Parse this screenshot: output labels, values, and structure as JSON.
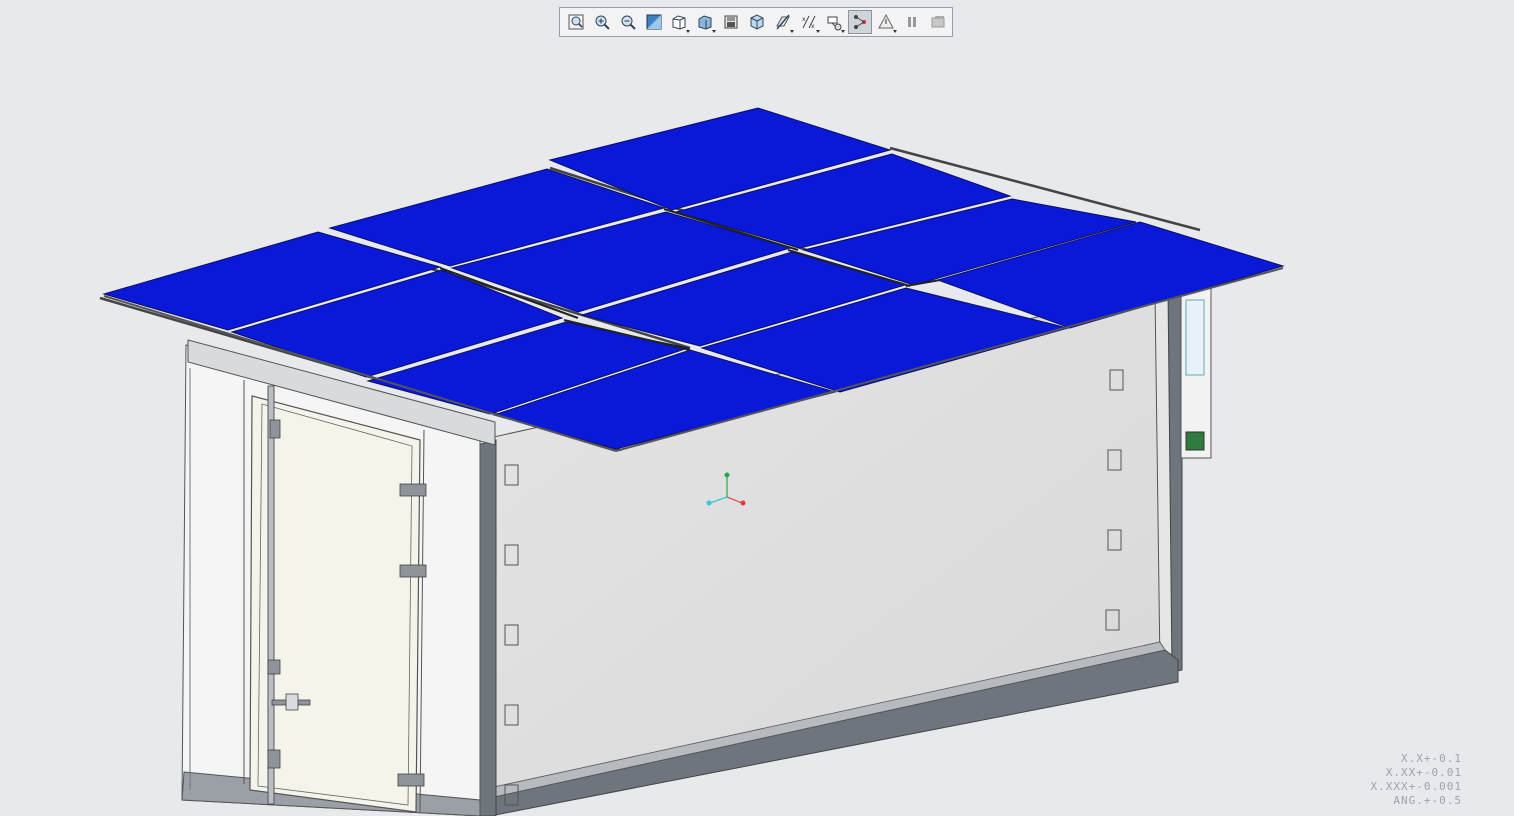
{
  "toolbar": {
    "buttons": [
      {
        "icon": "refit-icon",
        "active": false
      },
      {
        "icon": "zoom-in-icon",
        "active": false
      },
      {
        "icon": "zoom-out-icon",
        "active": false
      },
      {
        "icon": "repaint-icon",
        "active": false
      },
      {
        "icon": "saved-orientations-icon",
        "active": false
      },
      {
        "icon": "display-style-icon",
        "active": false
      },
      {
        "icon": "view-manager-icon",
        "active": false
      },
      {
        "icon": "perspective-view-icon",
        "active": false
      },
      {
        "icon": "section-icon",
        "active": false
      },
      {
        "icon": "datum-display-icon",
        "active": false
      },
      {
        "icon": "annotation-display-icon",
        "active": false
      },
      {
        "icon": "spin-center-icon",
        "active": true
      },
      {
        "icon": "simulation-display-icon",
        "active": false
      },
      {
        "icon": "pause-icon",
        "active": false
      },
      {
        "icon": "stop-icon",
        "active": false
      }
    ]
  },
  "model": {
    "panel_color": "#0a18d8",
    "frame_color": "#6f757c",
    "wall_color": "#e0e0e0",
    "door_color": "#f4f4ea"
  },
  "tolerance_note": {
    "line1": "X.X+-0.1",
    "line2": "X.XX+-0.01",
    "line3": "X.XXX+-0.001",
    "line4": "ANG.+-0.5"
  }
}
